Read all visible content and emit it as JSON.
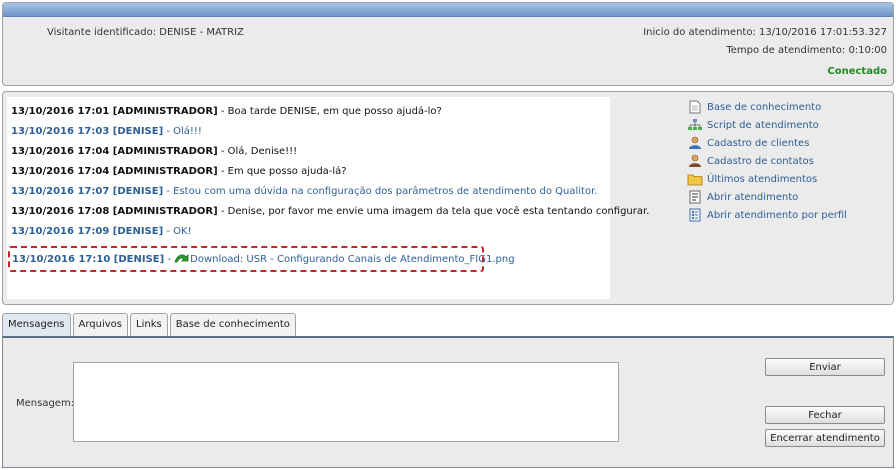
{
  "header": {
    "visitor": "Visitante identificado: DENISE - MATRIZ",
    "start_time": "Inicio do atendimento: 13/10/2016 17:01:53.327",
    "duration": "Tempo de atendimento: 0:10:00",
    "status": "Conectado",
    "status_color": "#1f8a1f"
  },
  "chat": {
    "messages": [
      {
        "role": "admin",
        "head": "13/10/2016 17:01 [ADMINISTRADOR]",
        "text": " - Boa tarde DENISE, em que posso ajudá-lo?"
      },
      {
        "role": "client",
        "head": "13/10/2016 17:03 [DENISE]",
        "text": " - Olá!!!"
      },
      {
        "role": "admin",
        "head": "13/10/2016 17:04 [ADMINISTRADOR]",
        "text": " - Olá, Denise!!!"
      },
      {
        "role": "admin",
        "head": "13/10/2016 17:04 [ADMINISTRADOR]",
        "text": " - Em que posso ajuda-lá?"
      },
      {
        "role": "client",
        "head": "13/10/2016 17:07 [DENISE]",
        "text": " - Estou com uma dúvida na configuração dos parâmetros de atendimento do Qualitor."
      },
      {
        "role": "admin",
        "head": "13/10/2016 17:08 [ADMINISTRADOR]",
        "text": " - Denise, por favor me envie uma imagem da tela que você esta tentando configurar."
      },
      {
        "role": "client",
        "head": "13/10/2016 17:09 [DENISE]",
        "text": " - OK!"
      }
    ],
    "attachment": {
      "head": "13/10/2016 17:10 [DENISE]",
      "sep": " - ",
      "icon": "download-arrow-icon",
      "link": "Download: USR - Configurando Canais de Atendimento_FIG1.png"
    }
  },
  "side_links": [
    {
      "icon": "document-icon",
      "label": "Base de conhecimento"
    },
    {
      "icon": "flowchart-icon",
      "label": "Script de atendimento"
    },
    {
      "icon": "user-icon",
      "label": "Cadastro de clientes"
    },
    {
      "icon": "contact-icon",
      "label": "Cadastro de contatos"
    },
    {
      "icon": "folder-icon",
      "label": "Últimos atendimentos"
    },
    {
      "icon": "form-icon",
      "label": "Abrir atendimento"
    },
    {
      "icon": "form-list-icon",
      "label": "Abrir atendimento por perfil"
    }
  ],
  "tabs": [
    "Mensagens",
    "Arquivos",
    "Links",
    "Base de conhecimento"
  ],
  "composer": {
    "label": "Mensagem:",
    "value": "",
    "send": "Enviar",
    "close": "Fechar",
    "end": "Encerrar atendimento"
  },
  "colors": {
    "client_text": "#2d5f96",
    "header_bar": "#6f97c9",
    "highlight_border": "#c8242a"
  }
}
